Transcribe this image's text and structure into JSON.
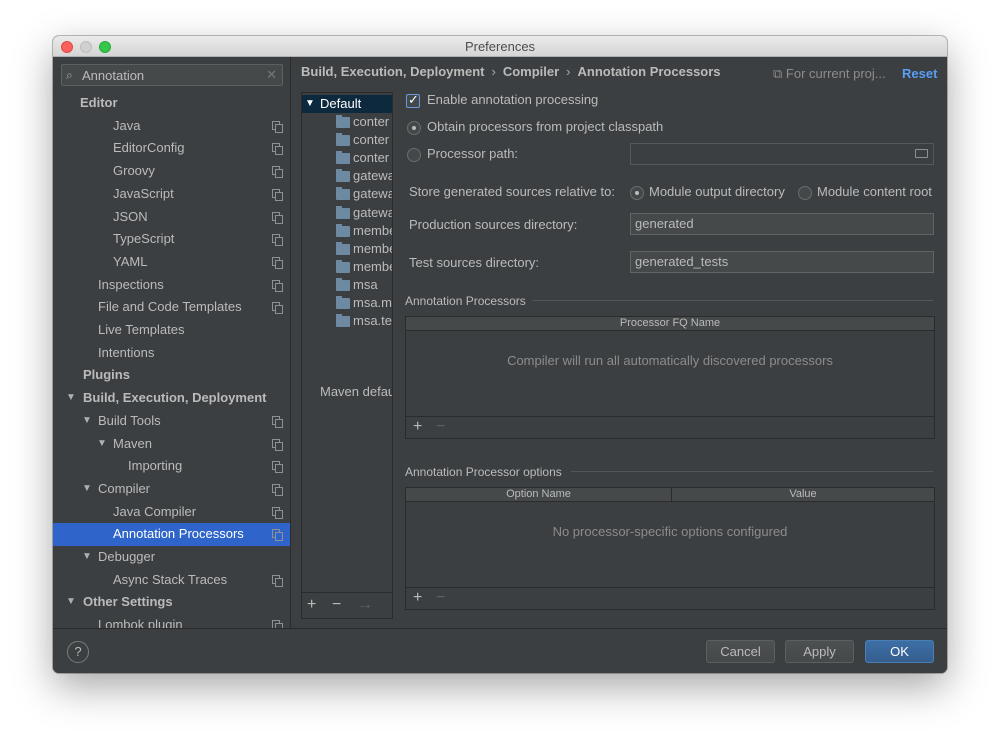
{
  "window": {
    "title": "Preferences"
  },
  "search": {
    "value": "Annotation"
  },
  "sidebar": {
    "items": [
      {
        "label": "Editor",
        "bold": true,
        "arrow": false,
        "copy": false
      },
      {
        "label": "Java",
        "copy": true
      },
      {
        "label": "EditorConfig",
        "copy": true
      },
      {
        "label": "Groovy",
        "copy": true
      },
      {
        "label": "JavaScript",
        "copy": true
      },
      {
        "label": "JSON",
        "copy": true
      },
      {
        "label": "TypeScript",
        "copy": true
      },
      {
        "label": "YAML",
        "copy": true
      },
      {
        "label": "Inspections",
        "copy": true
      },
      {
        "label": "File and Code Templates",
        "copy": true
      },
      {
        "label": "Live Templates",
        "copy": false
      },
      {
        "label": "Intentions",
        "copy": false
      },
      {
        "label": "Plugins",
        "bold": true,
        "copy": false
      },
      {
        "label": "Build, Execution, Deployment",
        "bold": true,
        "arrow": true,
        "copy": false
      },
      {
        "label": "Build Tools",
        "arrow": true,
        "copy": true
      },
      {
        "label": "Maven",
        "arrow": true,
        "copy": true
      },
      {
        "label": "Importing",
        "copy": true
      },
      {
        "label": "Compiler",
        "arrow": true,
        "copy": true
      },
      {
        "label": "Java Compiler",
        "copy": true
      },
      {
        "label": "Annotation Processors",
        "copy": true,
        "selected": true
      },
      {
        "label": "Debugger",
        "arrow": true,
        "copy": false
      },
      {
        "label": "Async Stack Traces",
        "copy": true
      },
      {
        "label": "Other Settings",
        "bold": true,
        "arrow": true,
        "copy": false
      },
      {
        "label": "Lombok plugin",
        "copy": true
      }
    ]
  },
  "breadcrumb": {
    "part1": "Build, Execution, Deployment",
    "part2": "Compiler",
    "part3": "Annotation Processors",
    "separator": "›"
  },
  "scope": {
    "label": "For current proj..."
  },
  "reset": {
    "label": "Reset"
  },
  "modules": {
    "root": "Default",
    "items": [
      "conter",
      "conter",
      "conter",
      "gatewa",
      "gatewa",
      "gatewa",
      "membe",
      "membe",
      "membe",
      "msa",
      "msa.m",
      "msa.te"
    ],
    "maven_label": "Maven defau"
  },
  "settings": {
    "enable_label": "Enable annotation processing",
    "obtain_label": "Obtain processors from project classpath",
    "processor_path_label": "Processor path:",
    "processor_path_value": "",
    "store_label": "Store generated sources relative to:",
    "module_output_label": "Module output directory",
    "module_content_label": "Module content root",
    "production_label": "Production sources directory:",
    "production_value": "generated",
    "test_label": "Test sources directory:",
    "test_value": "generated_tests"
  },
  "processors_section": {
    "title": "Annotation Processors",
    "column": "Processor FQ Name",
    "empty_text": "Compiler will run all automatically discovered processors"
  },
  "options_section": {
    "title": "Annotation Processor options",
    "col_name": "Option Name",
    "col_value": "Value",
    "empty_text": "No processor-specific options configured"
  },
  "toolbar": {
    "add": "+",
    "remove": "−",
    "move": "→"
  },
  "footer": {
    "help": "?",
    "cancel_label": "Cancel",
    "apply_label": "Apply",
    "ok_label": "OK"
  }
}
